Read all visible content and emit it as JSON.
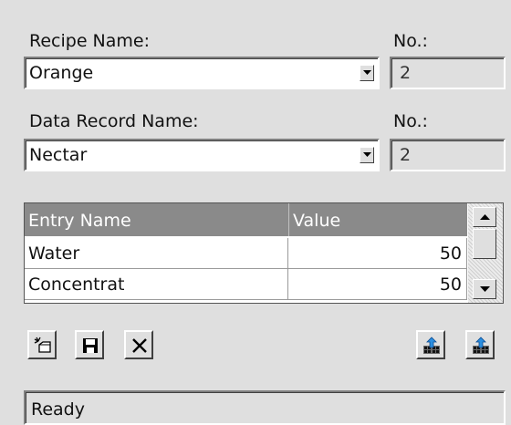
{
  "recipe": {
    "label": "Recipe Name:",
    "value": "Orange",
    "no_label": "No.:",
    "no_value": "2"
  },
  "record": {
    "label": "Data Record Name:",
    "value": "Nectar",
    "no_label": "No.:",
    "no_value": "2"
  },
  "table": {
    "headers": [
      "Entry Name",
      "Value"
    ],
    "rows": [
      {
        "name": "Water",
        "value": "50"
      },
      {
        "name": "Concentrat",
        "value": "50"
      }
    ]
  },
  "toolbar": {
    "icons": [
      "new-record-icon",
      "save-icon",
      "delete-icon",
      "export-icon",
      "import-icon"
    ]
  },
  "status": {
    "text": "Ready"
  }
}
